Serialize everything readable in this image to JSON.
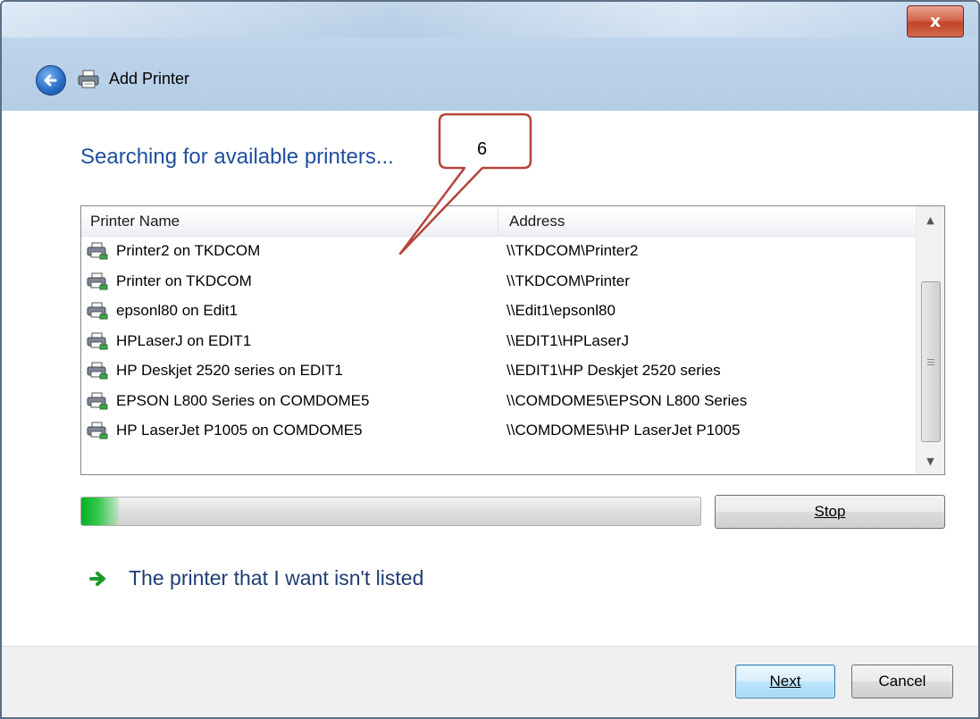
{
  "window": {
    "title": "Add Printer",
    "close_label": "x"
  },
  "main": {
    "heading": "Searching for available printers...",
    "columns": [
      "Printer Name",
      "Address"
    ],
    "printers": [
      {
        "name": "Printer2 on TKDCOM",
        "address": "\\\\TKDCOM\\Printer2"
      },
      {
        "name": "Printer on TKDCOM",
        "address": "\\\\TKDCOM\\Printer"
      },
      {
        "name": "epsonl80 on Edit1",
        "address": "\\\\Edit1\\epsonl80"
      },
      {
        "name": "HPLaserJ on EDIT1",
        "address": "\\\\EDIT1\\HPLaserJ"
      },
      {
        "name": "HP Deskjet 2520 series on EDIT1",
        "address": "\\\\EDIT1\\HP Deskjet 2520 series"
      },
      {
        "name": "EPSON L800 Series on COMDOME5",
        "address": "\\\\COMDOME5\\EPSON L800 Series"
      },
      {
        "name": "HP LaserJet P1005 on COMDOME5",
        "address": "\\\\COMDOME5\\HP LaserJet P1005"
      }
    ],
    "progress_fraction": 0.06,
    "stop_label": "Stop",
    "not_listed_link": "The printer that I want isn't listed"
  },
  "footer": {
    "next_label": "Next",
    "cancel_label": "Cancel"
  },
  "annotation": {
    "callout_label": "6"
  },
  "colors": {
    "heading": "#1e4fa0",
    "link": "#1e3d73",
    "progress": "#06b025",
    "callout": "#b5443a"
  }
}
